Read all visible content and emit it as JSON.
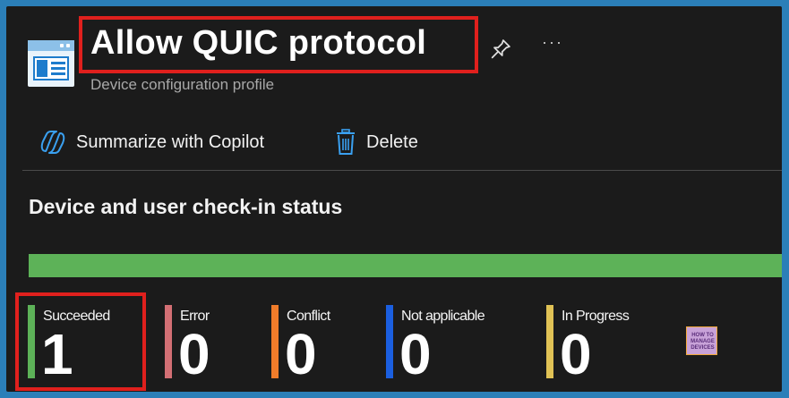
{
  "header": {
    "title": "Allow QUIC protocol",
    "subtitle": "Device configuration profile",
    "icon": "device-configuration-profile-icon",
    "more_label": "···"
  },
  "toolbar": {
    "summarize_label": "Summarize with Copilot",
    "delete_label": "Delete"
  },
  "status": {
    "section_title": "Device and user check-in status",
    "progress": {
      "succeeded_fraction": 1.0,
      "fill_color": "#5db258"
    },
    "items": [
      {
        "label": "Succeeded",
        "value": "1",
        "color": "#5db258"
      },
      {
        "label": "Error",
        "value": "0",
        "color": "#d36f74"
      },
      {
        "label": "Conflict",
        "value": "0",
        "color": "#f07c2a"
      },
      {
        "label": "Not applicable",
        "value": "0",
        "color": "#1b5fe0"
      },
      {
        "label": "In Progress",
        "value": "0",
        "color": "#e0c255"
      }
    ]
  },
  "watermark": {
    "line1": "HOW TO",
    "line2": "MANAGE",
    "line3": "DEVICES"
  },
  "colors": {
    "accent": "#2b7fb8",
    "highlight": "#e0201d",
    "background": "#1b1b1b"
  }
}
